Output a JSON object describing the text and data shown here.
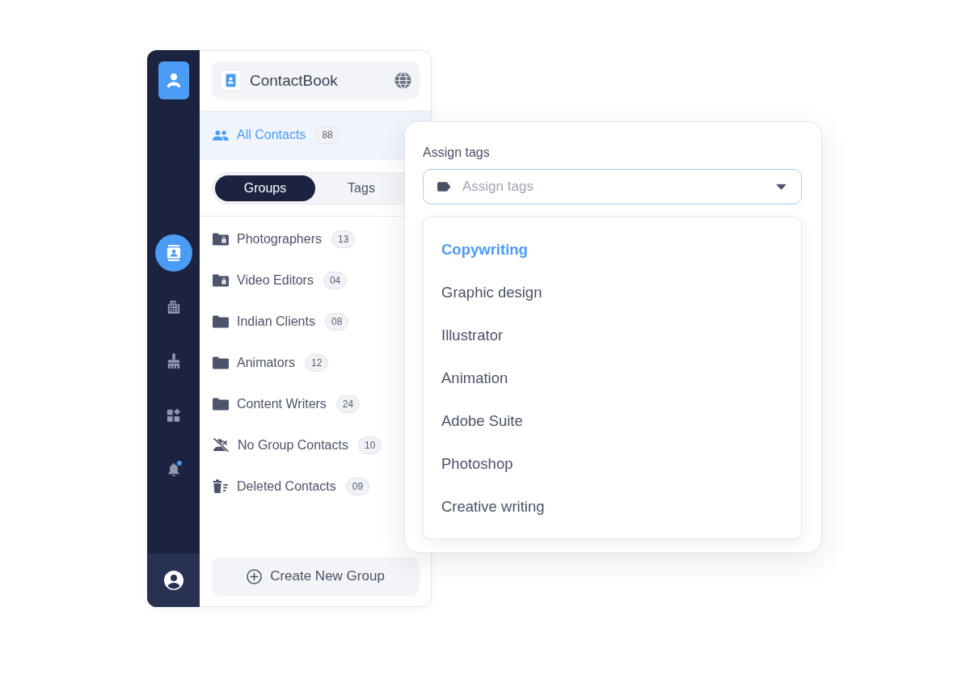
{
  "rail": {
    "items": [
      {
        "selected": true,
        "notification": false
      },
      {
        "selected": false,
        "notification": false
      },
      {
        "selected": false,
        "notification": false
      },
      {
        "selected": false,
        "notification": false
      },
      {
        "selected": false,
        "notification": true
      }
    ]
  },
  "app": {
    "title": "ContactBook"
  },
  "all_contacts": {
    "label": "All Contacts",
    "count": "88",
    "selected": true
  },
  "tabs": [
    {
      "label": "Groups",
      "selected": true
    },
    {
      "label": "Tags",
      "selected": false
    }
  ],
  "groups": [
    {
      "kind": "locked",
      "label": "Photographers",
      "count": "13",
      "selected": false
    },
    {
      "kind": "locked",
      "label": "Video Editors",
      "count": "04",
      "selected": false
    },
    {
      "kind": "folder",
      "label": "Indian Clients",
      "count": "08",
      "selected": false
    },
    {
      "kind": "folder",
      "label": "Animators",
      "count": "12",
      "selected": false
    },
    {
      "kind": "folder",
      "label": "Content Writers",
      "count": "24",
      "selected": false
    },
    {
      "kind": "ungrouped",
      "label": "No Group Contacts",
      "count": "10",
      "selected": false
    },
    {
      "kind": "trash",
      "label": "Deleted Contacts",
      "count": "09",
      "selected": false
    }
  ],
  "create_button": {
    "label": "Create New Group"
  },
  "tag_picker": {
    "label": "Assign tags",
    "placeholder": "Assign tags",
    "expanded": true,
    "options": [
      {
        "label": "Copywriting",
        "selected": true
      },
      {
        "label": "Graphic design",
        "selected": false
      },
      {
        "label": "Illustrator",
        "selected": false
      },
      {
        "label": "Animation",
        "selected": false
      },
      {
        "label": "Adobe Suite",
        "selected": false
      },
      {
        "label": "Photoshop",
        "selected": false
      },
      {
        "label": "Creative writing",
        "selected": false
      }
    ]
  }
}
